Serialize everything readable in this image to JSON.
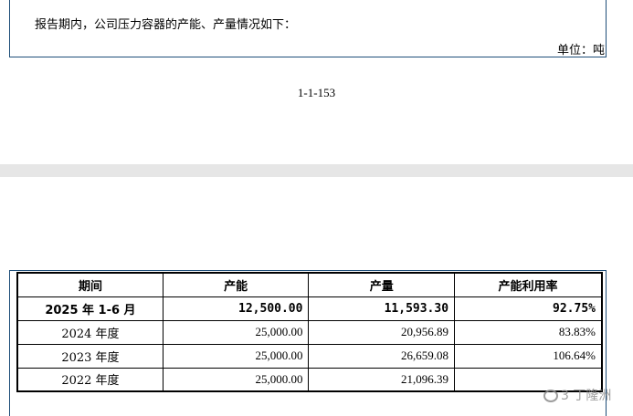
{
  "document": {
    "intro_text": "报告期内，公司压力容器的产能、产量情况如下：",
    "unit_text": "单位：吨",
    "page_number": "1-1-153"
  },
  "table": {
    "headers": [
      "期间",
      "产能",
      "产量",
      "产能利用率"
    ],
    "rows": [
      {
        "period": "2025 年 1-6 月",
        "capacity": "12,500.00",
        "output": "11,593.30",
        "utilization": "92.75%"
      },
      {
        "period": "2024 年度",
        "capacity": "25,000.00",
        "output": "20,956.89",
        "utilization": "83.83%"
      },
      {
        "period": "2023 年度",
        "capacity": "25,000.00",
        "output": "26,659.08",
        "utilization": "106.64%"
      },
      {
        "period": "2022 年度",
        "capacity": "25,000.00",
        "output": "21,096.39",
        "utilization": ""
      }
    ]
  },
  "watermark": {
    "text": "3 丁隆洲"
  }
}
